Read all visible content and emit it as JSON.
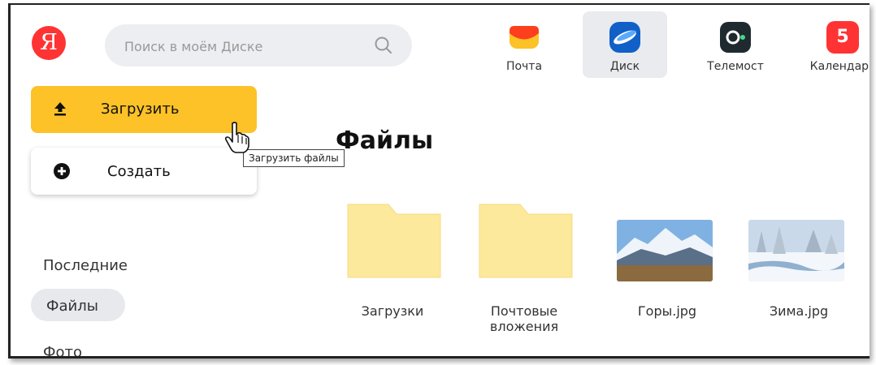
{
  "header": {
    "logo_letter": "Я",
    "search_placeholder": "Поиск в моём Диске",
    "services": [
      {
        "label": "Почта",
        "icon": "mail-envelope-icon",
        "color": "#fc3f1d"
      },
      {
        "label": "Диск",
        "icon": "disk-cloud-icon",
        "color": "#1a73e8",
        "active": true
      },
      {
        "label": "Телемост",
        "icon": "telemost-camera-icon",
        "color": "#1f2a30"
      },
      {
        "label": "Календарь",
        "icon": "calendar-icon",
        "color": "#f33",
        "day": "5"
      }
    ]
  },
  "sidebar": {
    "upload_label": "Загрузить",
    "create_label": "Создать",
    "nav": [
      "Последние",
      "Файлы",
      "Фото"
    ],
    "active_nav": "Файлы"
  },
  "tooltip": "Загрузить файлы",
  "main": {
    "title": "Файлы",
    "items": [
      {
        "label": "Загрузки",
        "type": "folder"
      },
      {
        "label": "Почтовые вложения",
        "type": "folder"
      },
      {
        "label": "Горы.jpg",
        "type": "image"
      },
      {
        "label": "Зима.jpg",
        "type": "image"
      }
    ]
  },
  "colors": {
    "accent": "#fcc227",
    "folder": "#fde99b",
    "brand_red": "#f33"
  }
}
